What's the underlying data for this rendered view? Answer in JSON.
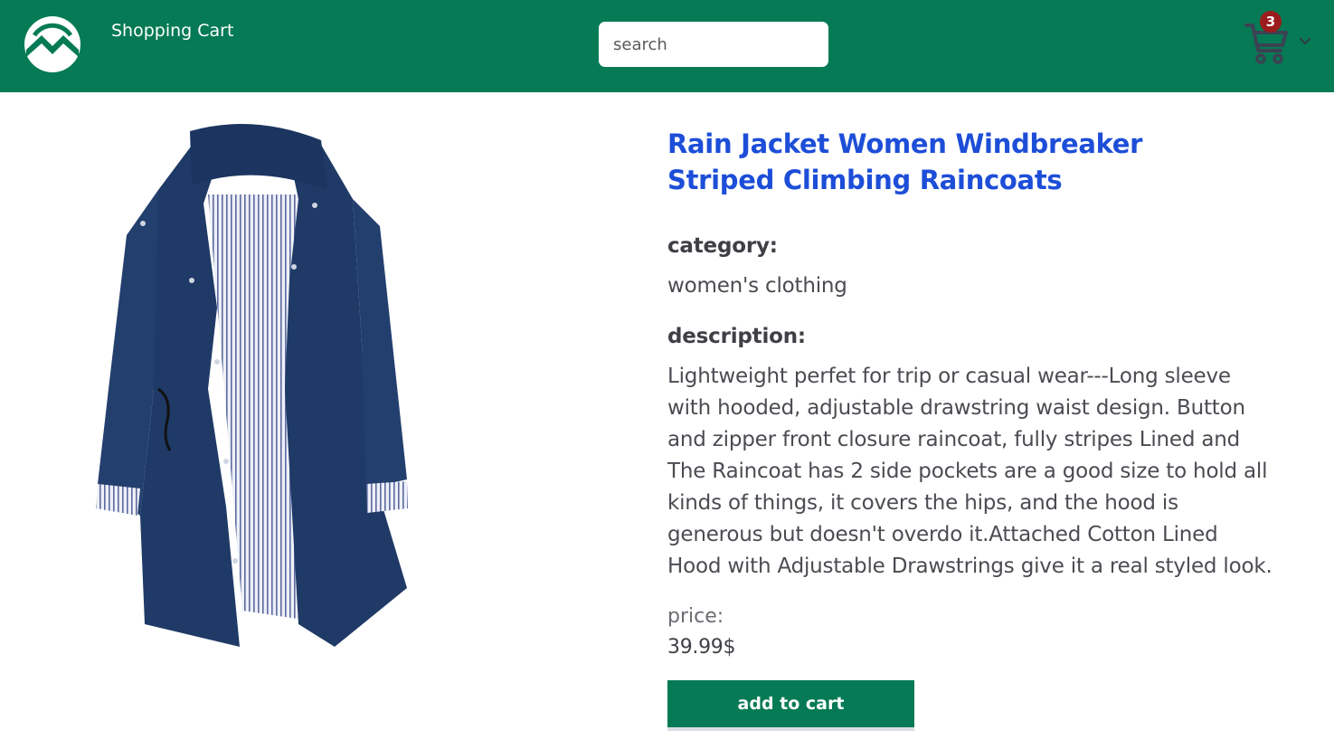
{
  "header": {
    "brand_label": "Shopping Cart",
    "search": {
      "placeholder": "search",
      "value": ""
    },
    "cart": {
      "count": "3",
      "icon": "shopping-cart-icon"
    },
    "logo_icon": "mountain-circle-logo"
  },
  "product": {
    "image_icon": "rain-jacket-photo",
    "title": "Rain Jacket Women Windbreaker Striped Climbing Raincoats",
    "category_label": "category:",
    "category": "women's clothing",
    "description_label": "description:",
    "description": "Lightweight perfet for trip or casual wear---Long sleeve with hooded, adjustable drawstring waist design. Button and zipper front closure raincoat, fully stripes Lined and The Raincoat has 2 side pockets are a good size to hold all kinds of things, it covers the hips, and the hood is generous but doesn't overdo it.Attached Cotton Lined Hood with Adjustable Drawstrings give it a real styled look.",
    "price_label": "price:",
    "price": "39.99$",
    "add_to_cart_label": "add to cart"
  },
  "colors": {
    "header_bg": "#057a55",
    "title": "#1d4ed8",
    "badge": "#9b1c1c",
    "button": "#057a55"
  }
}
